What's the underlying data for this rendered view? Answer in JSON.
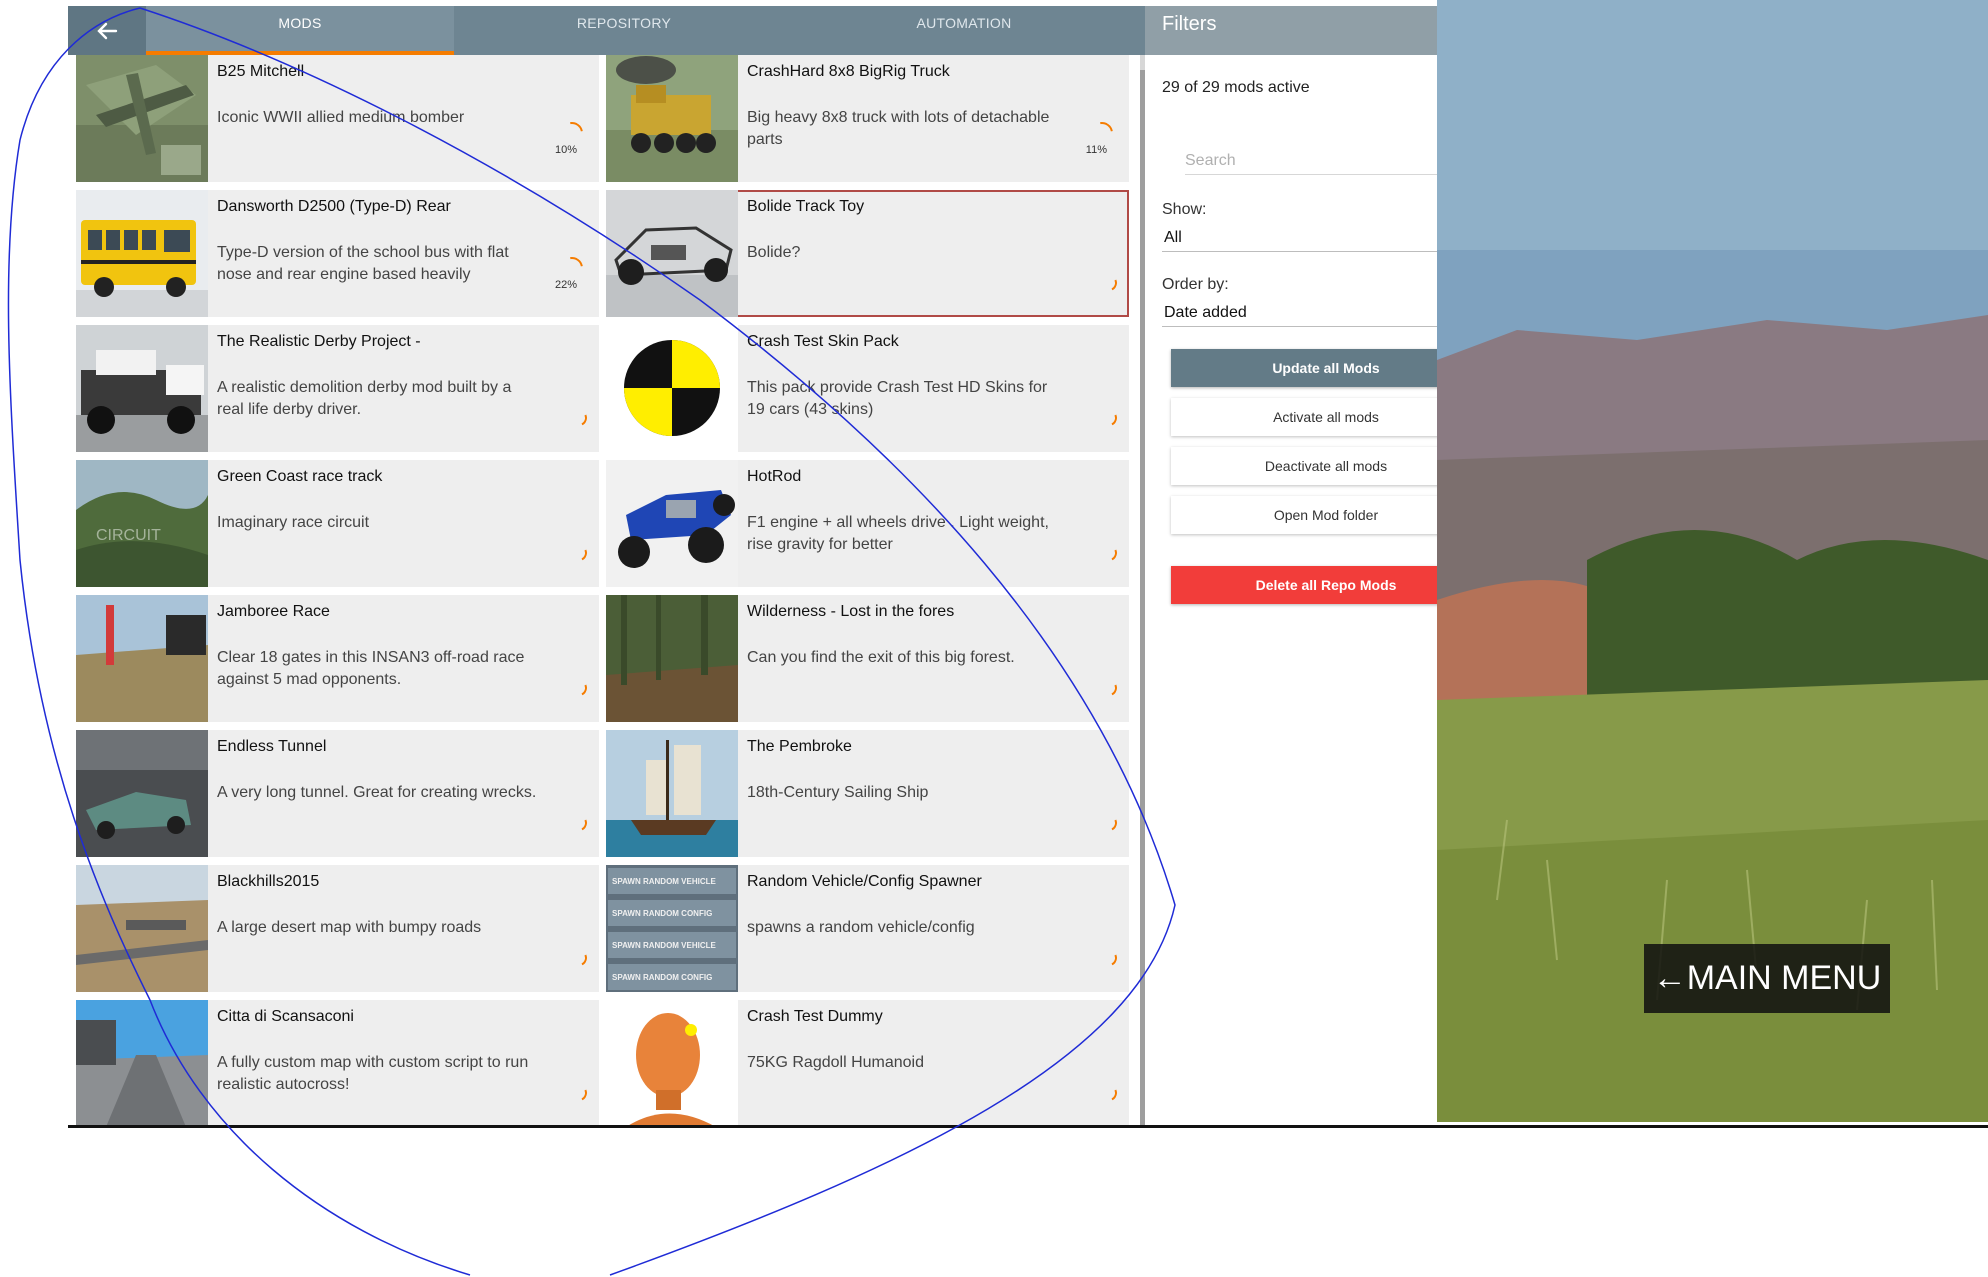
{
  "tabs": [
    {
      "label": "MODS",
      "active": true
    },
    {
      "label": "REPOSITORY",
      "active": false
    },
    {
      "label": "AUTOMATION",
      "active": false
    }
  ],
  "back_icon": "arrow-left-icon",
  "filters": {
    "title": "Filters",
    "active_count": "29 of 29 mods active",
    "search_placeholder": "Search",
    "show_label": "Show:",
    "show_value": "All",
    "order_label": "Order by:",
    "order_value": "Date added",
    "buttons": {
      "update_all": "Update all Mods",
      "activate_all": "Activate all mods",
      "deactivate_all": "Deactivate all mods",
      "open_folder": "Open Mod folder",
      "delete_repo": "Delete all Repo Mods"
    }
  },
  "mods": [
    {
      "title": "B25 Mitchell",
      "desc": "Iconic WWII allied medium bomber",
      "progress": "10%"
    },
    {
      "title": "CrashHard 8x8 BigRig Truck",
      "desc": "Big heavy 8x8 truck with lots of detachable parts",
      "progress": "11%"
    },
    {
      "title": "Dansworth D2500 (Type-D) Rear",
      "desc": "Type-D version of the school bus with flat nose and rear engine based heavily",
      "progress": "22%"
    },
    {
      "title": "Bolide Track Toy",
      "desc": "Bolide?",
      "progress": ""
    },
    {
      "title": "The Realistic Derby Project -",
      "desc": "A realistic demolition derby mod built by a real life derby driver.",
      "progress": ""
    },
    {
      "title": "Crash Test Skin Pack",
      "desc": "This pack provide Crash Test HD Skins for 19 cars (43 skins)",
      "progress": ""
    },
    {
      "title": "Green Coast race track",
      "desc": "Imaginary race circuit",
      "progress": ""
    },
    {
      "title": "HotRod",
      "desc": "F1 engine + all wheels drive . Light weight, rise gravity for better",
      "progress": ""
    },
    {
      "title": "Jamboree Race",
      "desc": "Clear 18 gates in this INSAN3 off-road race against 5 mad opponents.",
      "progress": ""
    },
    {
      "title": "Wilderness - Lost in the fores",
      "desc": "Can you find the exit of this big forest.",
      "progress": ""
    },
    {
      "title": "Endless Tunnel",
      "desc": "A very long tunnel. Great for creating wrecks.",
      "progress": ""
    },
    {
      "title": "The Pembroke",
      "desc": "18th-Century Sailing Ship",
      "progress": ""
    },
    {
      "title": "Blackhills2015",
      "desc": "A large desert map with bumpy roads",
      "progress": ""
    },
    {
      "title": "Random Vehicle/Config Spawner",
      "desc": "spawns a random vehicle/config",
      "progress": ""
    },
    {
      "title": "Citta di Scansaconi",
      "desc": "A fully custom map with custom script to run realistic autocross!",
      "progress": ""
    },
    {
      "title": "Crash Test Dummy",
      "desc": "75KG Ragdoll Humanoid",
      "progress": ""
    }
  ],
  "thumb_labels": {
    "green_coast": "CIRCUIT",
    "spawner": [
      "SPAWN RANDOM VEHICLE",
      "SPAWN RANDOM CONFIG",
      "SPAWN RANDOM VEHICLE",
      "SPAWN RANDOM CONFIG"
    ]
  },
  "main_menu": "←MAIN MENU",
  "colors": {
    "topbar": "#6e8592",
    "accent": "#f57c00",
    "danger": "#f23d3a",
    "primary_button": "#637b87",
    "card": "#eeeeee",
    "ink_scribble": "#1f2bd6"
  }
}
